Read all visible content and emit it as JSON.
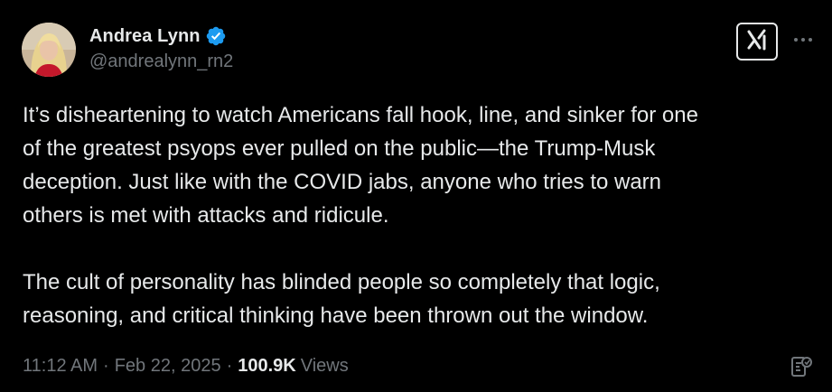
{
  "author": {
    "display_name": "Andrea Lynn",
    "handle": "@andrealynn_rn2",
    "verified": true,
    "verified_color": "#1d9bf0"
  },
  "icons": {
    "avatar": "profile-photo",
    "verified": "verified-badge-icon",
    "grok": "grok-icon",
    "more": "more-options-icon",
    "analytics": "analytics-icon"
  },
  "tweet": {
    "paragraphs": [
      "It’s disheartening to watch Americans fall hook, line, and sinker for one\nof the greatest psyops ever pulled on the public—the Trump-Musk\ndeception. Just like with the COVID jabs, anyone who tries to warn\nothers is met with attacks and ridicule.",
      "The cult of personality has blinded people so completely that logic,\nreasoning, and critical thinking have been thrown out the window."
    ]
  },
  "meta": {
    "time": "11:12 AM",
    "separator": "·",
    "date": "Feb 22, 2025",
    "separator2": "·",
    "views_count": "100.9K",
    "views_label": "Views"
  },
  "colors": {
    "background": "#000000",
    "primary_text": "#e7e9ea",
    "secondary_text": "#71767b"
  }
}
